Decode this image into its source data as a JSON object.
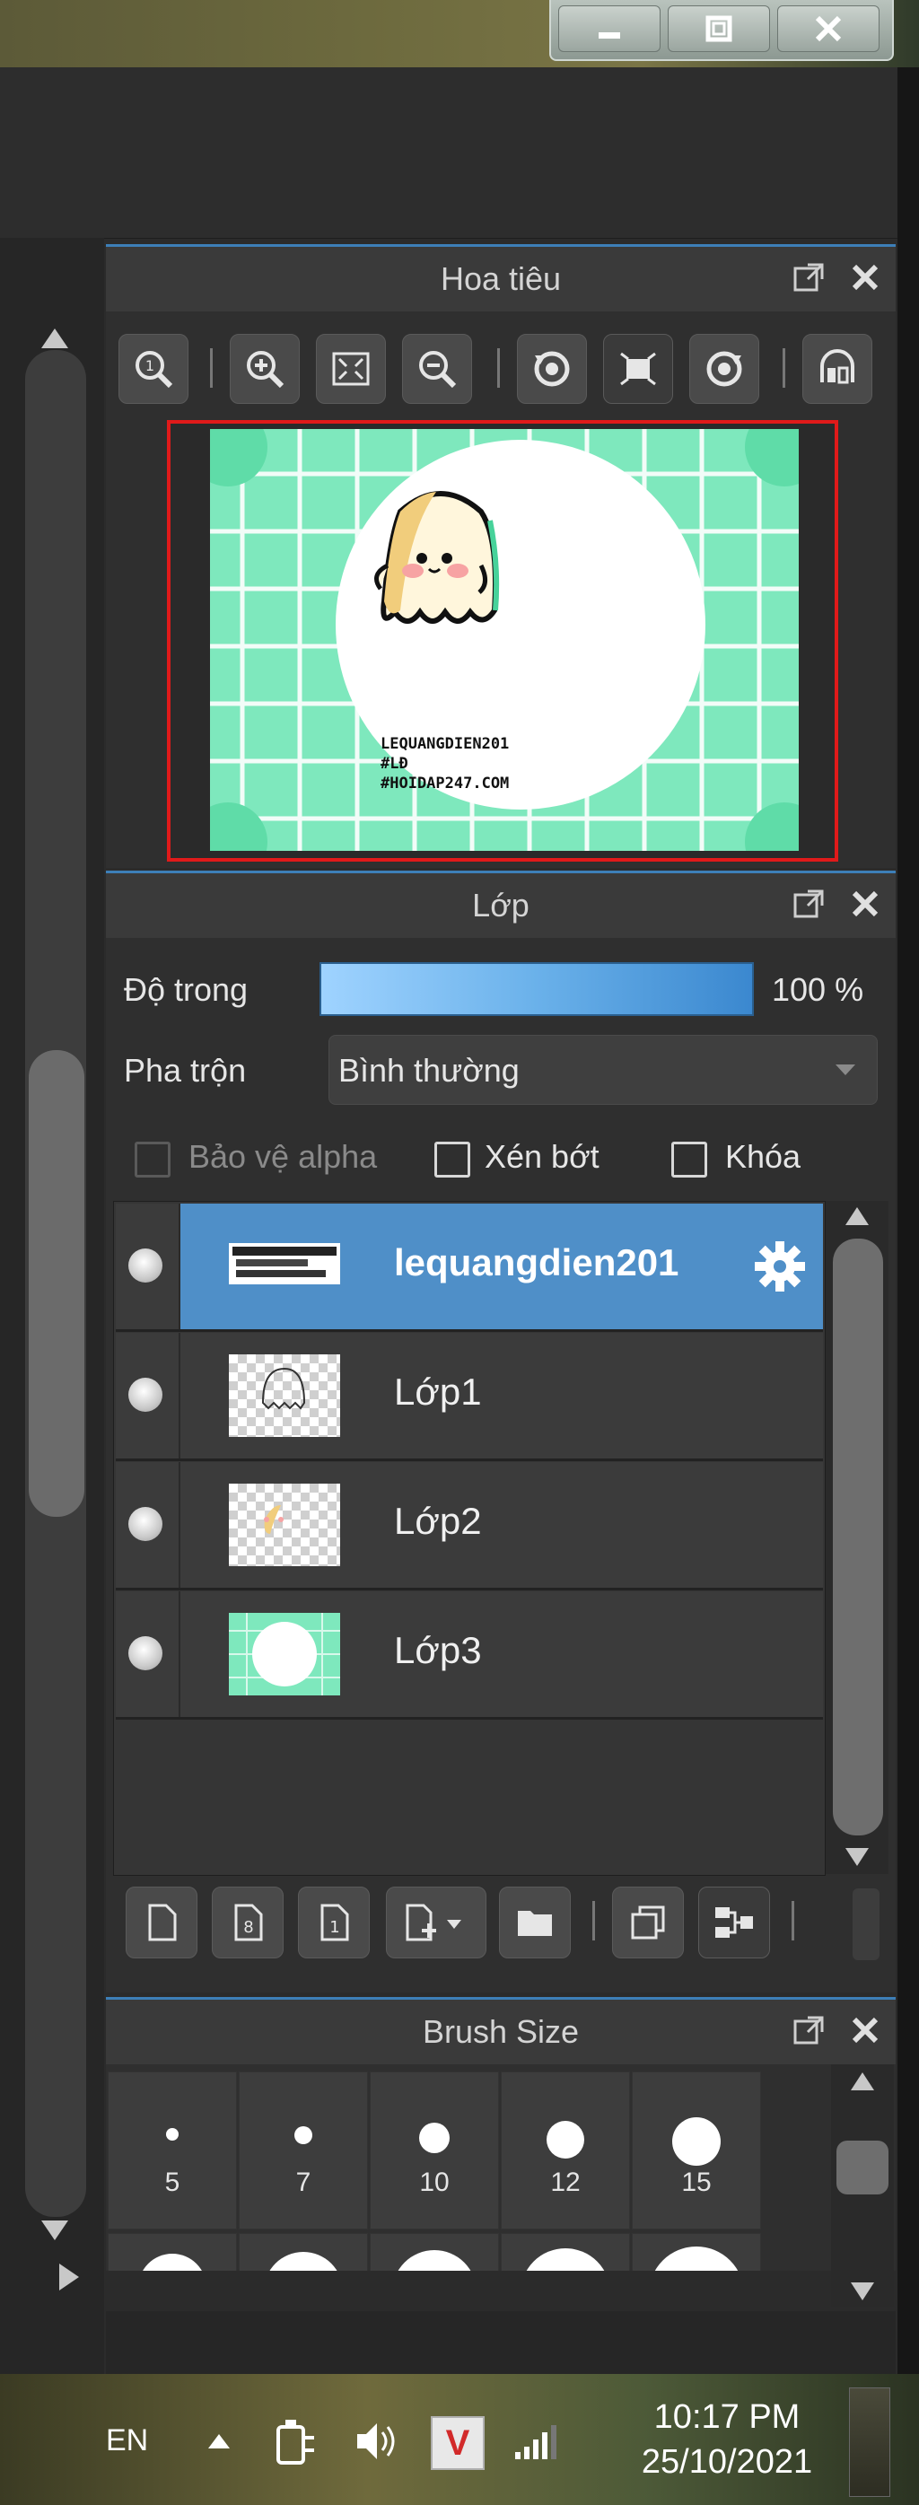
{
  "window": {
    "minimize_icon": "minimize-icon",
    "restore_icon": "restore-icon",
    "close_icon": "close-icon"
  },
  "navigator": {
    "title": "Hoa tiêu",
    "preview_text": [
      "LEQUANGDIEN201",
      "#LĐ",
      "#HOIDAP247.COM"
    ],
    "tools": [
      "zoom-100-icon",
      "zoom-in-icon",
      "fit-window-icon",
      "zoom-out-icon",
      "rotate-left-icon",
      "reset-view-icon",
      "rotate-right-icon",
      "flip-icon"
    ]
  },
  "layers": {
    "title": "Lớp",
    "opacity_label": "Độ trong",
    "opacity_value": "100 %",
    "opacity_fraction": 1.0,
    "blend_label": "Pha trộn",
    "blend_value": "Bình thường",
    "protect_alpha_label": "Bảo vệ alpha",
    "clip_label": "Xén bớt",
    "lock_label": "Khóa",
    "items": [
      {
        "name": "lequangdien201",
        "active": true
      },
      {
        "name": "Lớp1",
        "active": false
      },
      {
        "name": "Lớp2",
        "active": false
      },
      {
        "name": "Lớp3",
        "active": false
      }
    ]
  },
  "brush_size": {
    "title": "Brush Size",
    "sizes": [
      "5",
      "7",
      "10",
      "12",
      "15"
    ]
  },
  "taskbar": {
    "language": "EN",
    "time": "10:17 PM",
    "date": "25/10/2021",
    "vivaldi_letter": "V"
  },
  "colors": {
    "accent": "#4f8fc8",
    "panel_bg": "#2f2f2f",
    "nav_frame": "#e01a1a",
    "canvas_mint": "#7ee8bd"
  }
}
